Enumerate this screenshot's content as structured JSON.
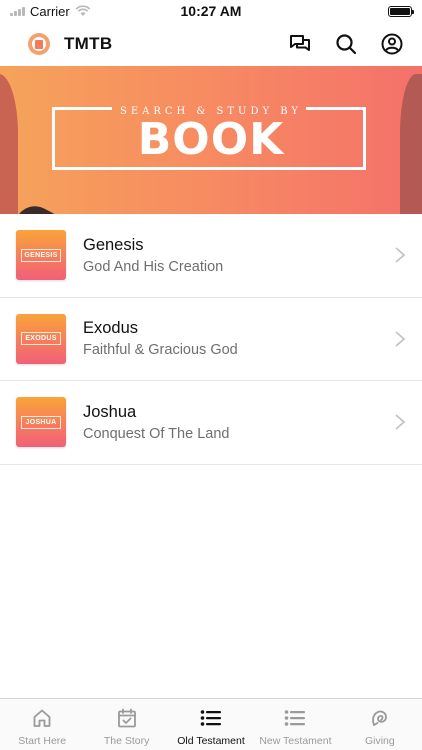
{
  "status_bar": {
    "carrier": "Carrier",
    "time": "10:27 AM"
  },
  "header": {
    "title": "TMTB"
  },
  "hero": {
    "subtitle": "SEARCH & STUDY BY",
    "title": "BOOK"
  },
  "books": [
    {
      "name": "Genesis",
      "description": "God And His Creation",
      "thumb_label": "GENESIS"
    },
    {
      "name": "Exodus",
      "description": "Faithful & Gracious God",
      "thumb_label": "EXODUS"
    },
    {
      "name": "Joshua",
      "description": "Conquest Of The Land",
      "thumb_label": "JOSHUA"
    }
  ],
  "tabs": [
    {
      "label": "Start Here",
      "icon": "home-icon"
    },
    {
      "label": "The Story",
      "icon": "calendar-check-icon"
    },
    {
      "label": "Old Testament",
      "icon": "list-icon",
      "active": true
    },
    {
      "label": "New Testament",
      "icon": "list-icon"
    },
    {
      "label": "Giving",
      "icon": "giving-icon"
    }
  ],
  "colors": {
    "accent_gradient_start": "#f5a35a",
    "accent_gradient_end": "#f4716a",
    "active_tab": "#111111",
    "inactive_tab": "#9a9a9a"
  }
}
